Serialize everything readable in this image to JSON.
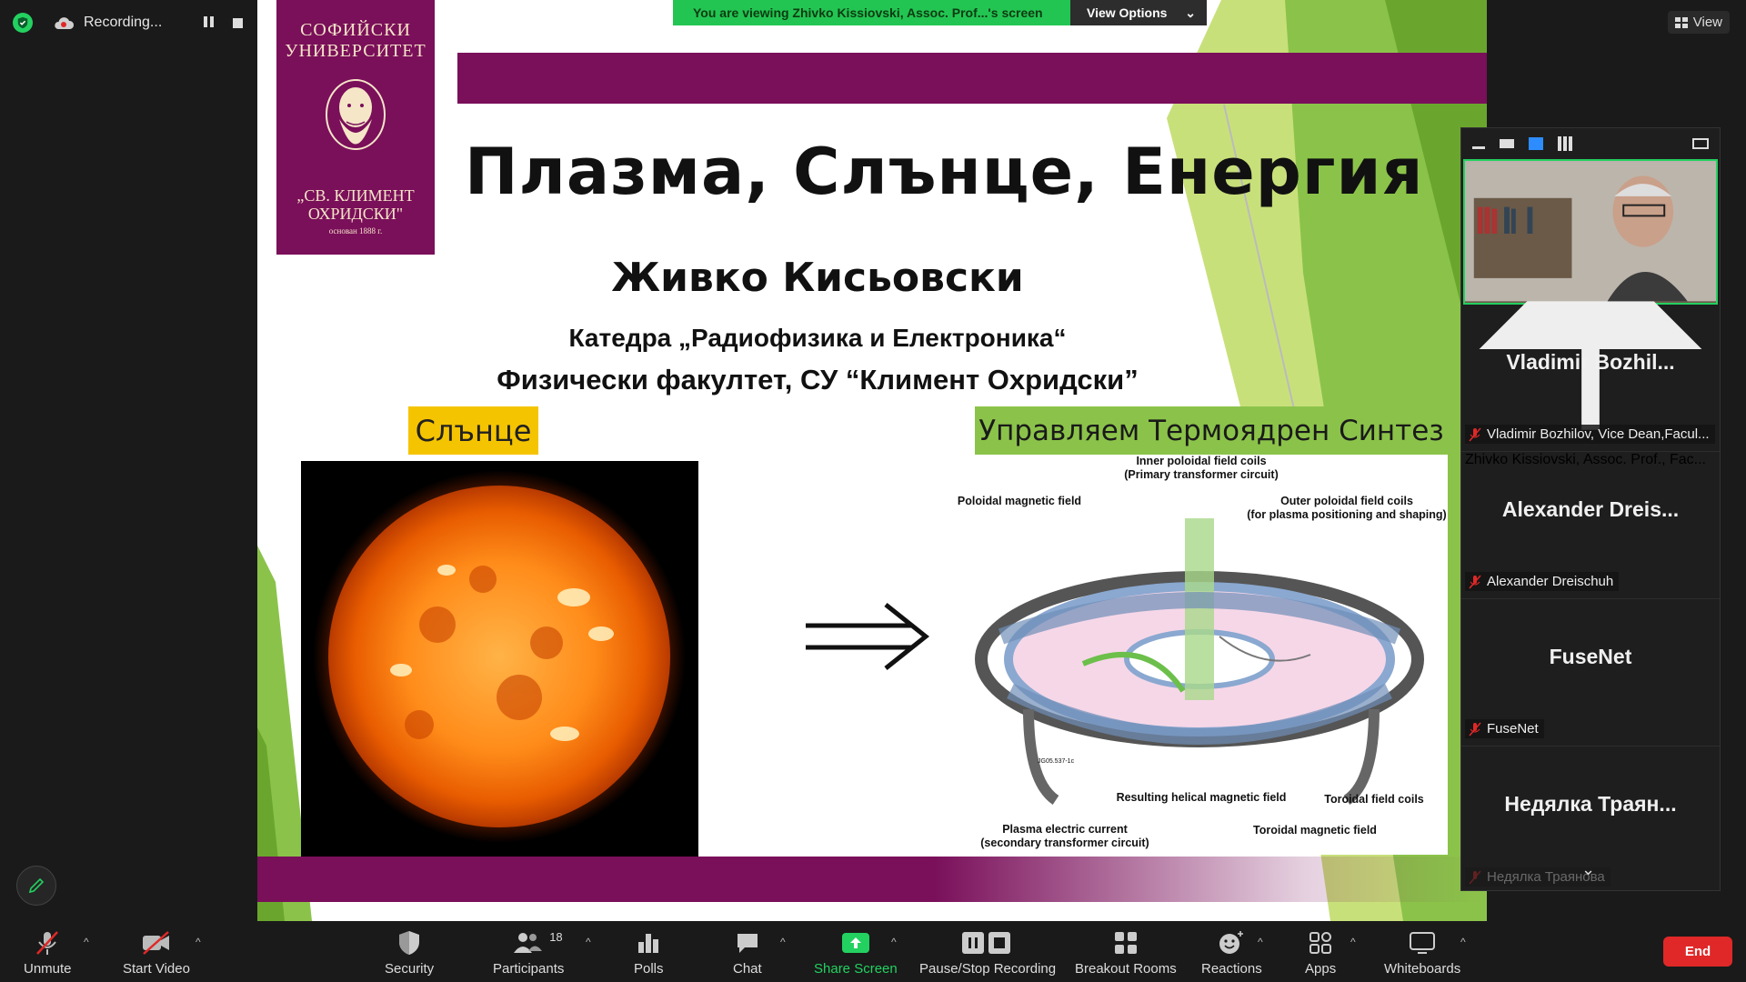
{
  "recording": {
    "label": "Recording..."
  },
  "banner": {
    "message": "You are viewing Zhivko Kissiovski, Assoc. Prof...'s screen",
    "options_label": "View Options"
  },
  "view_button": {
    "label": "View"
  },
  "slide": {
    "university_line1": "СОФИЙСКИ",
    "university_line2": "УНИВЕРСИТЕТ",
    "university_line3": "„СВ. КЛИМЕНТ",
    "university_line4": "ОХРИДСКИ\"",
    "university_founded": "основан 1888 г.",
    "title": "Плазма, Слънце, Енергия",
    "author": "Живко Кисьовски",
    "department": "Катедра „Радиофизика и Електроника“",
    "faculty": "Физически факултет, СУ “Климент Охридски”",
    "sun_label": "Слънце",
    "fusion_label": "Управляем Термоядрен Синтез",
    "diagram": {
      "inner_coils": "Inner poloidal field coils",
      "inner_coils_sub": "(Primary transformer circuit)",
      "poloidal_field": "Poloidal magnetic field",
      "outer_coils": "Outer poloidal field coils",
      "outer_coils_sub": "(for plasma positioning and shaping)",
      "helical_field": "Resulting helical magnetic field",
      "toroidal_coils": "Toroidal field coils",
      "plasma_current": "Plasma electric current",
      "plasma_current_sub": "(secondary transformer circuit)",
      "toroidal_field": "Toroidal magnetic field",
      "figure_code": "JG05.537-1c"
    }
  },
  "participants": [
    {
      "tile_name": "",
      "label": "Zhivko Kissiovski, Assoc. Prof., Fac...",
      "muted": false,
      "video": true
    },
    {
      "tile_name": "Vladimir  Bozhil...",
      "label": "Vladimir Bozhilov, Vice Dean,Facul...",
      "muted": true,
      "video": false
    },
    {
      "tile_name": "Alexander  Dreis...",
      "label": "Alexander Dreischuh",
      "muted": true,
      "video": false
    },
    {
      "tile_name": "FuseNet",
      "label": "FuseNet",
      "muted": true,
      "video": false
    },
    {
      "tile_name": "Недялка  Траян...",
      "label": "Недялка Траянова",
      "muted": true,
      "video": false
    }
  ],
  "toolbar": {
    "unmute": "Unmute",
    "start_video": "Start Video",
    "security": "Security",
    "participants": "Participants",
    "participants_count": "18",
    "polls": "Polls",
    "chat": "Chat",
    "share_screen": "Share Screen",
    "pause_stop_recording": "Pause/Stop Recording",
    "breakout_rooms": "Breakout Rooms",
    "reactions": "Reactions",
    "apps": "Apps",
    "whiteboards": "Whiteboards",
    "end": "End"
  },
  "colors": {
    "accent_green": "#23c552",
    "slide_purple": "#7a0f5a",
    "end_red": "#e02828",
    "share_green": "#23d160"
  }
}
